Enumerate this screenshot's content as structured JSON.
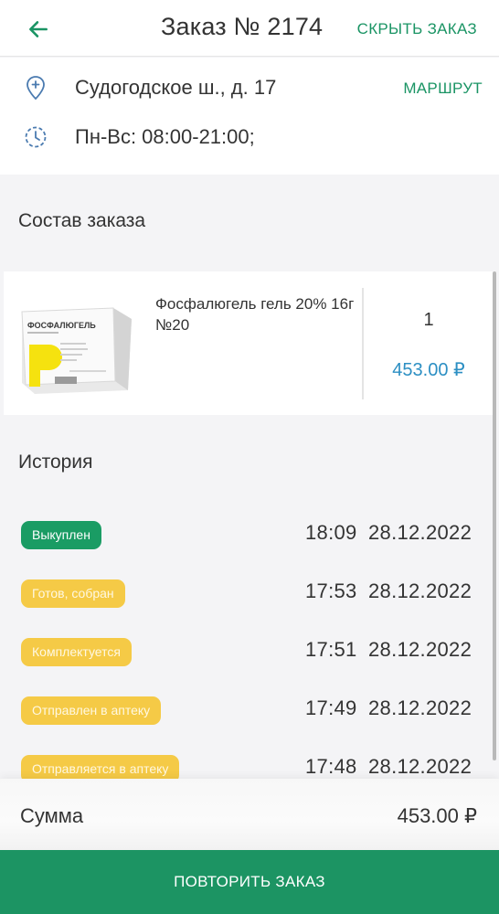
{
  "header": {
    "title": "Заказ № 2174",
    "hide_label": "СКРЫТЬ ЗАКАЗ",
    "back_icon": "arrow-left-icon"
  },
  "pharmacy": {
    "address": "Судогодское ш., д. 17",
    "route_label": "МАРШРУТ",
    "hours": "Пн-Вс: 08:00-21:00;",
    "address_icon": "location-pin-icon",
    "hours_icon": "clock-icon"
  },
  "order": {
    "section_title": "Состав заказа",
    "items": [
      {
        "name": "Фосфалюгель гель 20% 16г №20",
        "quantity": "1",
        "price": "453.00 ₽",
        "package_brand": "ФОСФАЛЮГЕЛЬ",
        "package_letter": "P"
      }
    ]
  },
  "history": {
    "section_title": "История",
    "entries": [
      {
        "status": "Выкуплен",
        "time": "18:09",
        "date": "28.12.2022",
        "color": "#1a9c64"
      },
      {
        "status": "Готов, собран",
        "time": "17:53",
        "date": "28.12.2022",
        "color": "#f5ca46"
      },
      {
        "status": "Комплектуется",
        "time": "17:51",
        "date": "28.12.2022",
        "color": "#f5ca46"
      },
      {
        "status": "Отправлен в аптеку",
        "time": "17:49",
        "date": "28.12.2022",
        "color": "#f5ca46"
      },
      {
        "status": "Отправляется в аптеку",
        "time": "17:48",
        "date": "28.12.2022",
        "color": "#f5ca46"
      }
    ]
  },
  "summary": {
    "label": "Сумма",
    "value": "453.00 ₽"
  },
  "footer": {
    "repeat_label": "ПОВТОРИТЬ ЗАКАЗ"
  },
  "colors": {
    "accent": "#1a9464",
    "price": "#2c8fc3",
    "status_done": "#1a9c64",
    "status_progress": "#f5ca46"
  }
}
